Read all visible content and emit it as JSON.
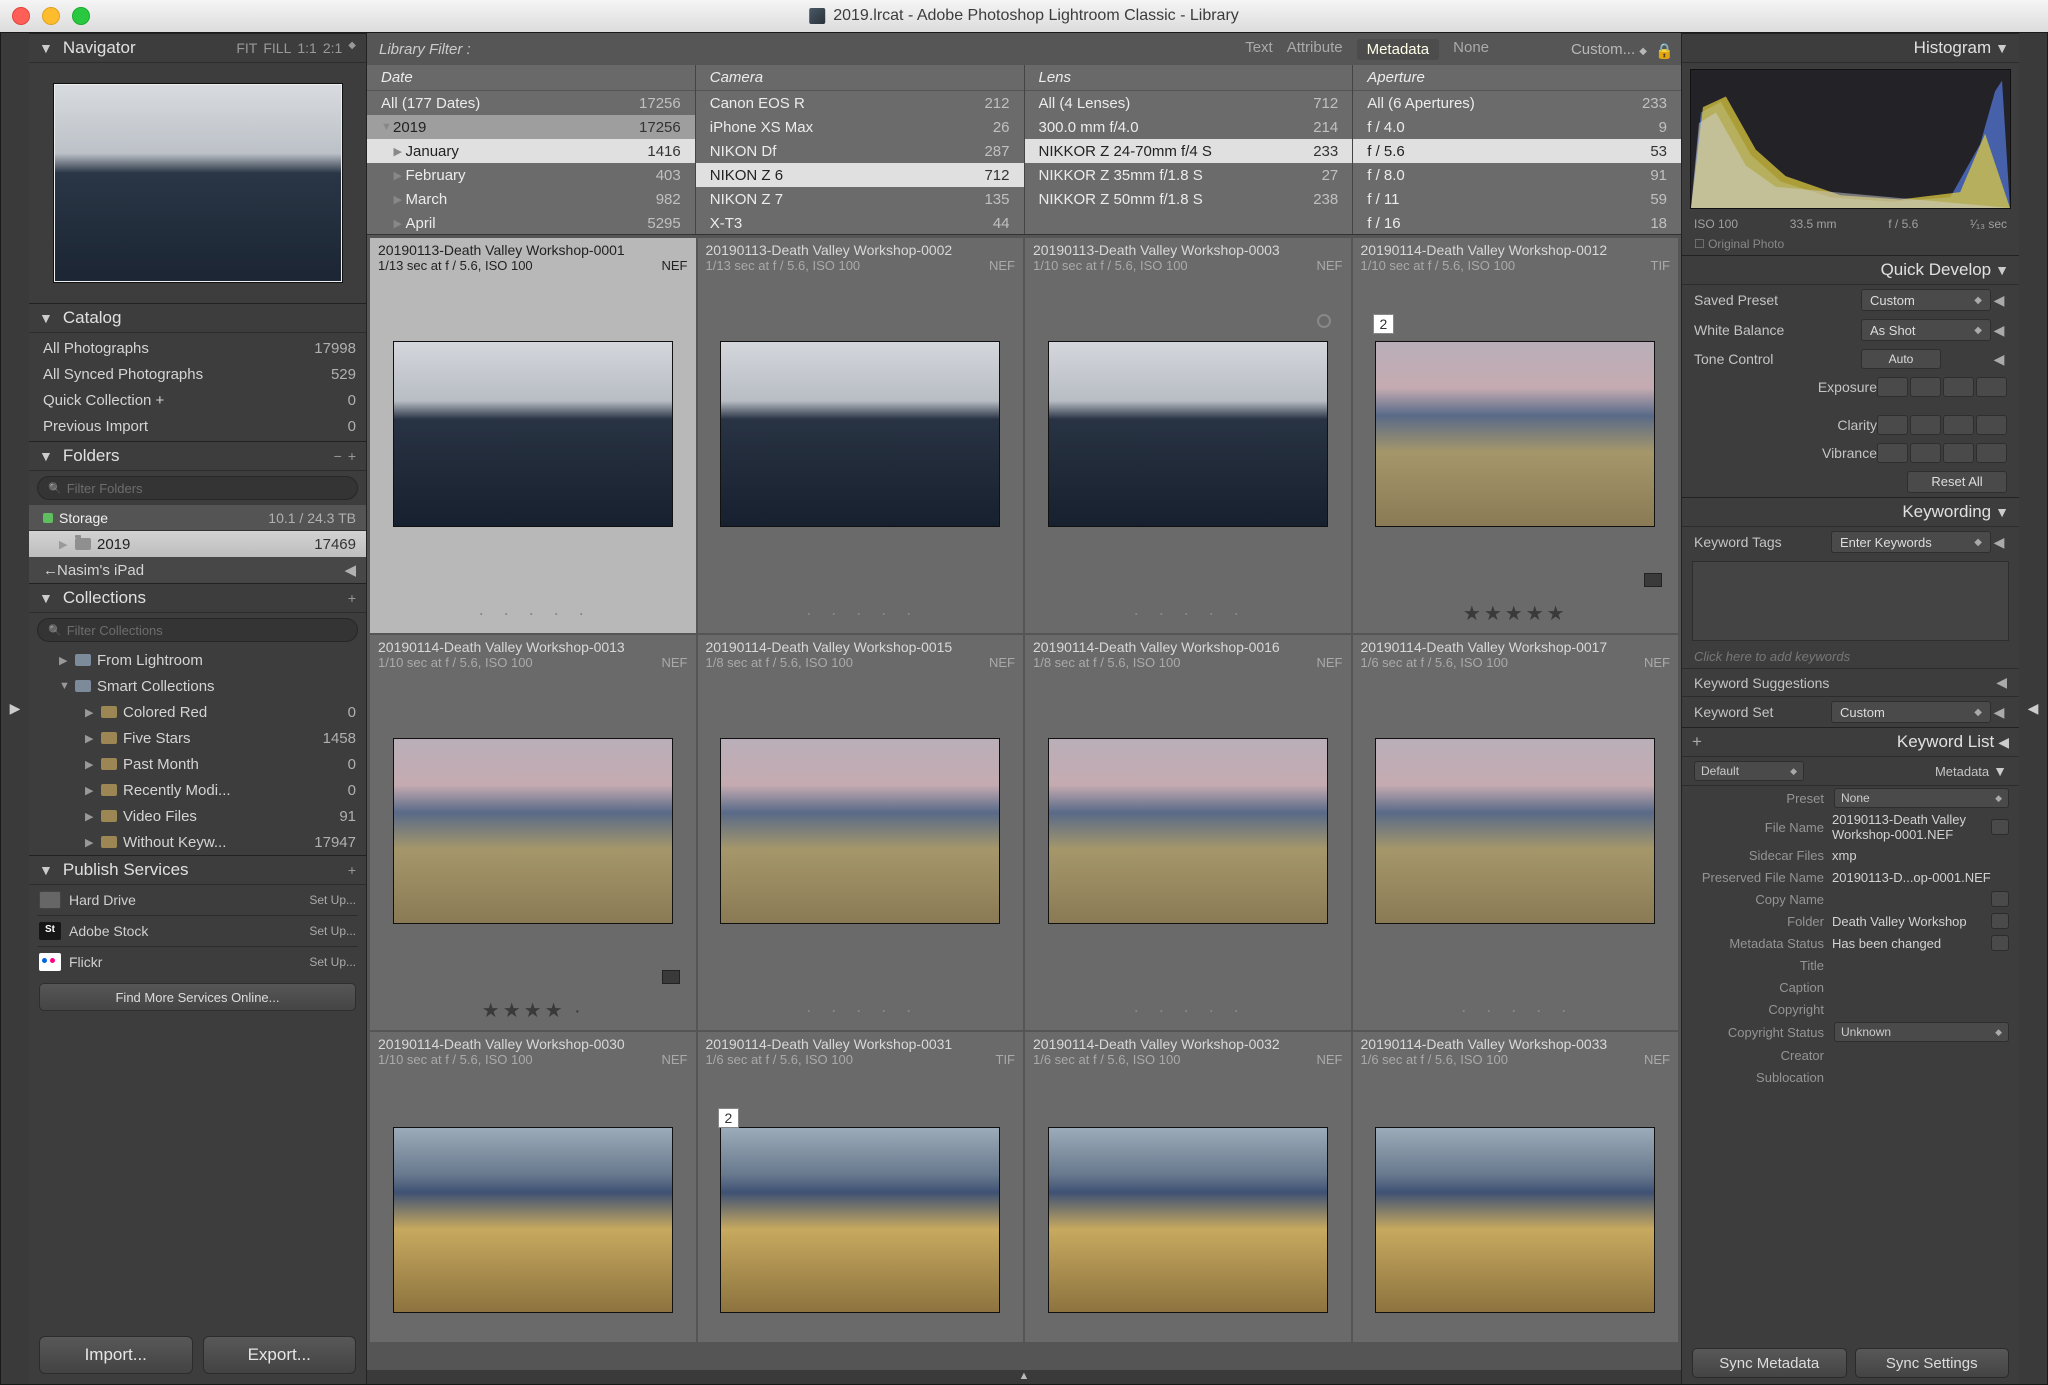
{
  "window": {
    "title": "2019.lrcat - Adobe Photoshop Lightroom Classic - Library"
  },
  "navigator": {
    "title": "Navigator",
    "modes": [
      "FIT",
      "FILL",
      "1:1",
      "2:1"
    ]
  },
  "catalog": {
    "title": "Catalog",
    "items": [
      {
        "label": "All Photographs",
        "count": "17998"
      },
      {
        "label": "All Synced Photographs",
        "count": "529"
      },
      {
        "label": "Quick Collection  +",
        "count": "0"
      },
      {
        "label": "Previous Import",
        "count": "0"
      }
    ]
  },
  "folders": {
    "title": "Folders",
    "filter_placeholder": "Filter Folders",
    "drive": {
      "label": "Storage",
      "meta": "10.1 / 24.3 TB"
    },
    "year": {
      "label": "2019",
      "count": "17469"
    },
    "ipad": "Nasim's iPad"
  },
  "collections": {
    "title": "Collections",
    "filter_placeholder": "Filter Collections",
    "from_lr": "From Lightroom",
    "smart": "Smart Collections",
    "items": [
      {
        "label": "Colored Red",
        "count": "0"
      },
      {
        "label": "Five Stars",
        "count": "1458"
      },
      {
        "label": "Past Month",
        "count": "0"
      },
      {
        "label": "Recently Modi...",
        "count": "0"
      },
      {
        "label": "Video Files",
        "count": "91"
      },
      {
        "label": "Without Keyw...",
        "count": "17947"
      }
    ]
  },
  "publish": {
    "title": "Publish Services",
    "hd": "Hard Drive",
    "stock": "Adobe Stock",
    "flickr": "Flickr",
    "setup": "Set Up...",
    "find": "Find More Services Online..."
  },
  "buttons": {
    "import": "Import...",
    "export": "Export..."
  },
  "filter": {
    "label": "Library Filter :",
    "tabs": [
      "Text",
      "Attribute",
      "Metadata",
      "None"
    ],
    "active": "Metadata",
    "custom": "Custom..."
  },
  "filter_cols": {
    "date": {
      "title": "Date",
      "rows": [
        {
          "label": "All (177 Dates)",
          "count": "17256",
          "pre": ""
        },
        {
          "label": "2019",
          "count": "17256",
          "pre": "▼",
          "hl": true
        },
        {
          "label": "January",
          "count": "1416",
          "pre": "▶",
          "indent": true,
          "sel": true
        },
        {
          "label": "February",
          "count": "403",
          "pre": "▶",
          "indent": true
        },
        {
          "label": "March",
          "count": "982",
          "pre": "▶",
          "indent": true
        },
        {
          "label": "April",
          "count": "5295",
          "pre": "▶",
          "indent": true
        }
      ]
    },
    "camera": {
      "title": "Camera",
      "rows": [
        {
          "label": "Canon EOS R",
          "count": "212"
        },
        {
          "label": "iPhone XS Max",
          "count": "26"
        },
        {
          "label": "NIKON Df",
          "count": "287"
        },
        {
          "label": "NIKON Z 6",
          "count": "712",
          "sel": true
        },
        {
          "label": "NIKON Z 7",
          "count": "135"
        },
        {
          "label": "X-T3",
          "count": "44"
        }
      ]
    },
    "lens": {
      "title": "Lens",
      "rows": [
        {
          "label": "All (4 Lenses)",
          "count": "712"
        },
        {
          "label": "300.0 mm f/4.0",
          "count": "214"
        },
        {
          "label": "NIKKOR Z 24-70mm f/4 S",
          "count": "233",
          "sel": true
        },
        {
          "label": "NIKKOR Z 35mm f/1.8 S",
          "count": "27"
        },
        {
          "label": "NIKKOR Z 50mm f/1.8 S",
          "count": "238"
        }
      ]
    },
    "aperture": {
      "title": "Aperture",
      "rows": [
        {
          "label": "All (6 Apertures)",
          "count": "233"
        },
        {
          "label": "f / 4.0",
          "count": "9"
        },
        {
          "label": "f / 5.6",
          "count": "53",
          "sel": true
        },
        {
          "label": "f / 8.0",
          "count": "91"
        },
        {
          "label": "f / 11",
          "count": "59"
        },
        {
          "label": "f / 16",
          "count": "18"
        }
      ]
    }
  },
  "grid": [
    [
      {
        "title": "20190113-Death Valley Workshop-0001",
        "sub": "1/13 sec at f / 5.6, ISO 100",
        "ext": "NEF",
        "kind": "dark",
        "selected": true
      },
      {
        "title": "20190113-Death Valley Workshop-0002",
        "sub": "1/13 sec at f / 5.6, ISO 100",
        "ext": "NEF",
        "kind": "dark"
      },
      {
        "title": "20190113-Death Valley Workshop-0003",
        "sub": "1/10 sec at f / 5.6, ISO 100",
        "ext": "NEF",
        "kind": "dark",
        "circle": true
      },
      {
        "title": "20190114-Death Valley Workshop-0012",
        "sub": "1/10 sec at f / 5.6, ISO 100",
        "ext": "TIF",
        "kind": "pink",
        "badge": "2",
        "stars": "★★★★★",
        "corner": true
      }
    ],
    [
      {
        "title": "20190114-Death Valley Workshop-0013",
        "sub": "1/10 sec at f / 5.6, ISO 100",
        "ext": "NEF",
        "kind": "pink",
        "stars": "★★★★ ·",
        "corner": true
      },
      {
        "title": "20190114-Death Valley Workshop-0015",
        "sub": "1/8 sec at f / 5.6, ISO 100",
        "ext": "NEF",
        "kind": "pink"
      },
      {
        "title": "20190114-Death Valley Workshop-0016",
        "sub": "1/8 sec at f / 5.6, ISO 100",
        "ext": "NEF",
        "kind": "pink"
      },
      {
        "title": "20190114-Death Valley Workshop-0017",
        "sub": "1/6 sec at f / 5.6, ISO 100",
        "ext": "NEF",
        "kind": "pink"
      }
    ],
    [
      {
        "title": "20190114-Death Valley Workshop-0030",
        "sub": "1/10 sec at f / 5.6, ISO 100",
        "ext": "NEF",
        "kind": "orange"
      },
      {
        "title": "20190114-Death Valley Workshop-0031",
        "sub": "1/6 sec at f / 5.6, ISO 100",
        "ext": "TIF",
        "kind": "orange",
        "badge": "2"
      },
      {
        "title": "20190114-Death Valley Workshop-0032",
        "sub": "1/6 sec at f / 5.6, ISO 100",
        "ext": "NEF",
        "kind": "orange"
      },
      {
        "title": "20190114-Death Valley Workshop-0033",
        "sub": "1/6 sec at f / 5.6, ISO 100",
        "ext": "NEF",
        "kind": "orange"
      }
    ]
  ],
  "histogram": {
    "title": "Histogram",
    "info": [
      "ISO 100",
      "33.5 mm",
      "f / 5.6",
      "¹⁄₁₃ sec"
    ],
    "orig": "Original Photo"
  },
  "quick_develop": {
    "title": "Quick Develop",
    "saved_preset": {
      "label": "Saved Preset",
      "value": "Custom"
    },
    "white_balance": {
      "label": "White Balance",
      "value": "As Shot"
    },
    "tone": {
      "label": "Tone Control",
      "auto": "Auto"
    },
    "exposure": "Exposure",
    "clarity": "Clarity",
    "vibrance": "Vibrance",
    "reset": "Reset All"
  },
  "keywording": {
    "title": "Keywording",
    "tags": {
      "label": "Keyword Tags",
      "value": "Enter Keywords"
    },
    "hint": "Click here to add keywords",
    "sugg": "Keyword Suggestions",
    "set": {
      "label": "Keyword Set",
      "value": "Custom"
    }
  },
  "keyword_list": {
    "title": "Keyword List",
    "default": "Default"
  },
  "metadata_panel": {
    "title": "Metadata",
    "preset": {
      "label": "Preset",
      "value": "None"
    },
    "rows": [
      {
        "label": "File Name",
        "value": "20190113-Death Valley Workshop-0001.NEF",
        "btn": true
      },
      {
        "label": "Sidecar Files",
        "value": "xmp"
      },
      {
        "label": "Preserved File Name",
        "value": "20190113-D...op-0001.NEF"
      },
      {
        "label": "Copy Name",
        "value": "",
        "btn": true
      },
      {
        "label": "Folder",
        "value": "Death Valley Workshop",
        "btn": true
      },
      {
        "label": "Metadata Status",
        "value": "Has been changed",
        "btn": true
      },
      {
        "label": "Title",
        "value": ""
      },
      {
        "label": "Caption",
        "value": ""
      },
      {
        "label": "Copyright",
        "value": ""
      },
      {
        "label": "Copyright Status",
        "value": "Unknown",
        "dd": true
      },
      {
        "label": "Creator",
        "value": ""
      },
      {
        "label": "Sublocation",
        "value": ""
      }
    ]
  },
  "sync": {
    "meta": "Sync Metadata",
    "settings": "Sync Settings"
  }
}
